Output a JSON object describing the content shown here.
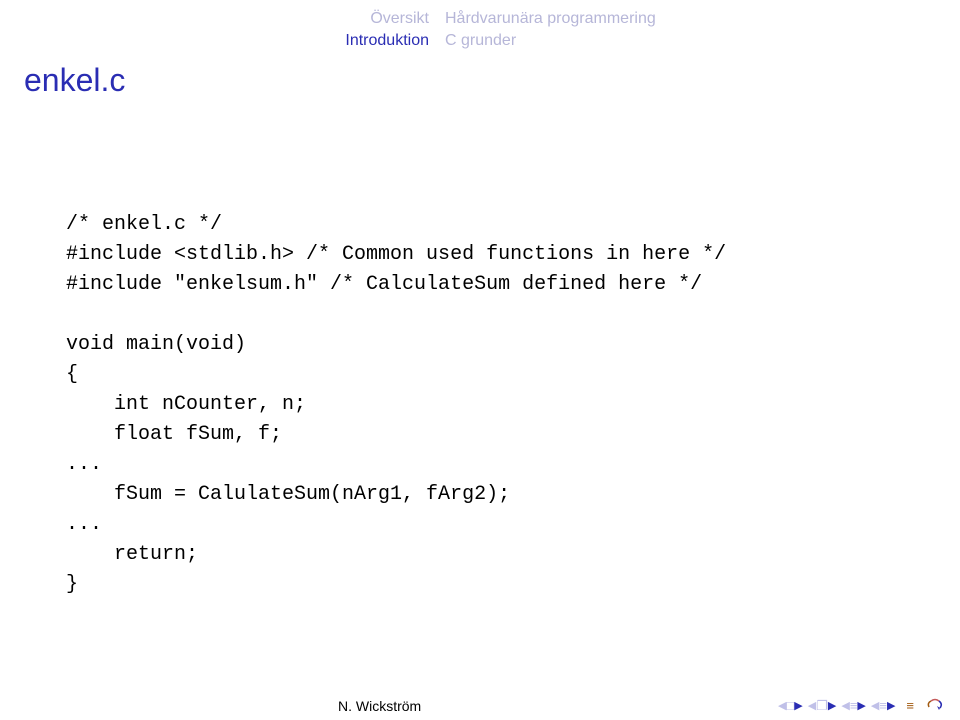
{
  "nav": {
    "sections": [
      {
        "label": "Översikt",
        "active": false
      },
      {
        "label": "Introduktion",
        "active": true
      }
    ],
    "subsections": [
      {
        "label": "Hårdvarunära programmering"
      },
      {
        "label": "C grunder"
      }
    ]
  },
  "frametitle": "enkel.c",
  "code": "/* enkel.c */\n#include <stdlib.h> /* Common used functions in here */\n#include \"enkelsum.h\" /* CalculateSum defined here */\n\nvoid main(void)\n{\n    int nCounter, n;\n    float fSum, f;\n...\n    fSum = CalulateSum(nArg1, fArg2);\n...\n    return;\n}",
  "footer": {
    "author": "N. Wickström"
  },
  "controls": {
    "first": "◀",
    "last": "▶",
    "box": "□",
    "doc": "❐",
    "eq1": "≡",
    "eq2": "≡",
    "eqmain": "≡",
    "recycle": "↻"
  }
}
